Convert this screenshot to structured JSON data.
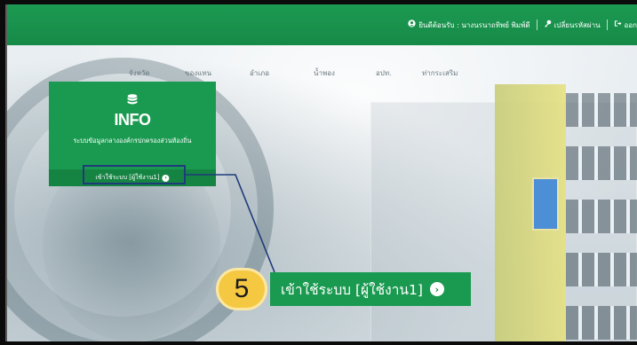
{
  "topbar": {
    "welcome_text": "ยินดีต้อนรับ : นางนรนาถทิพย์ พิมพ์ดี",
    "change_password": "เปลี่ยนรหัสผ่าน",
    "logout": "ออก"
  },
  "nav": {
    "items": [
      "จังหวัด",
      "ของแทน",
      "อำเภอ",
      "น้ำพอง",
      "อปท.",
      "ท่ากระเสริม"
    ]
  },
  "info_card": {
    "title": "INFO",
    "subtitle": "ระบบข้อมูลกลางองค์กรปกครองส่วนท้องถิ่น",
    "enter_link": "เข้าใช้ระบบ [ผู้ใช้งาน1]"
  },
  "callout": {
    "step_number": "5",
    "label": "เข้าใช้ระบบ [ผู้ใช้งาน1]"
  },
  "colors": {
    "brand_green": "#1a9a50",
    "highlight_box": "#1f3a7a",
    "step_badge": "#f5c842"
  },
  "icons": {
    "user": "user-circle-icon",
    "key": "key-icon",
    "logout": "logout-icon",
    "database": "database-icon",
    "arrow": "arrow-circle-right-icon"
  }
}
